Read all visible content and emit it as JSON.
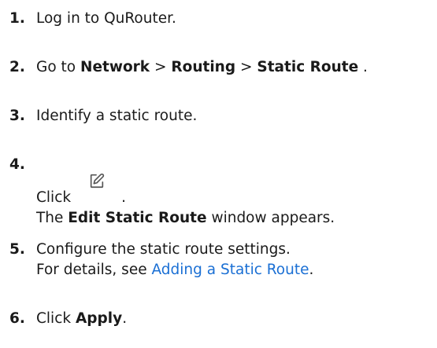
{
  "steps": [
    {
      "number": "1.",
      "text": "Log in to QuRouter."
    },
    {
      "number": "2.",
      "prefix": "Go to ",
      "bold1": "Network",
      "sep1": " > ",
      "bold2": "Routing",
      "sep2": " > ",
      "bold3": "Static Route",
      "suffix": " ."
    },
    {
      "number": "3.",
      "text": "Identify a static route."
    },
    {
      "number": "4.",
      "click": "Click",
      "period": ".",
      "icon": "edit-icon",
      "result_prefix": "The ",
      "result_bold": "Edit Static Route",
      "result_suffix": " window appears."
    },
    {
      "number": "5.",
      "text": "Configure the static route settings.",
      "details_prefix": "For details, see ",
      "details_link": "Adding a Static Route",
      "details_suffix": "."
    },
    {
      "number": "6.",
      "prefix": "Click ",
      "bold": "Apply",
      "suffix": "."
    }
  ],
  "colors": {
    "text": "#1a1a1a",
    "link": "#1a6fd4",
    "icon": "#555555"
  }
}
